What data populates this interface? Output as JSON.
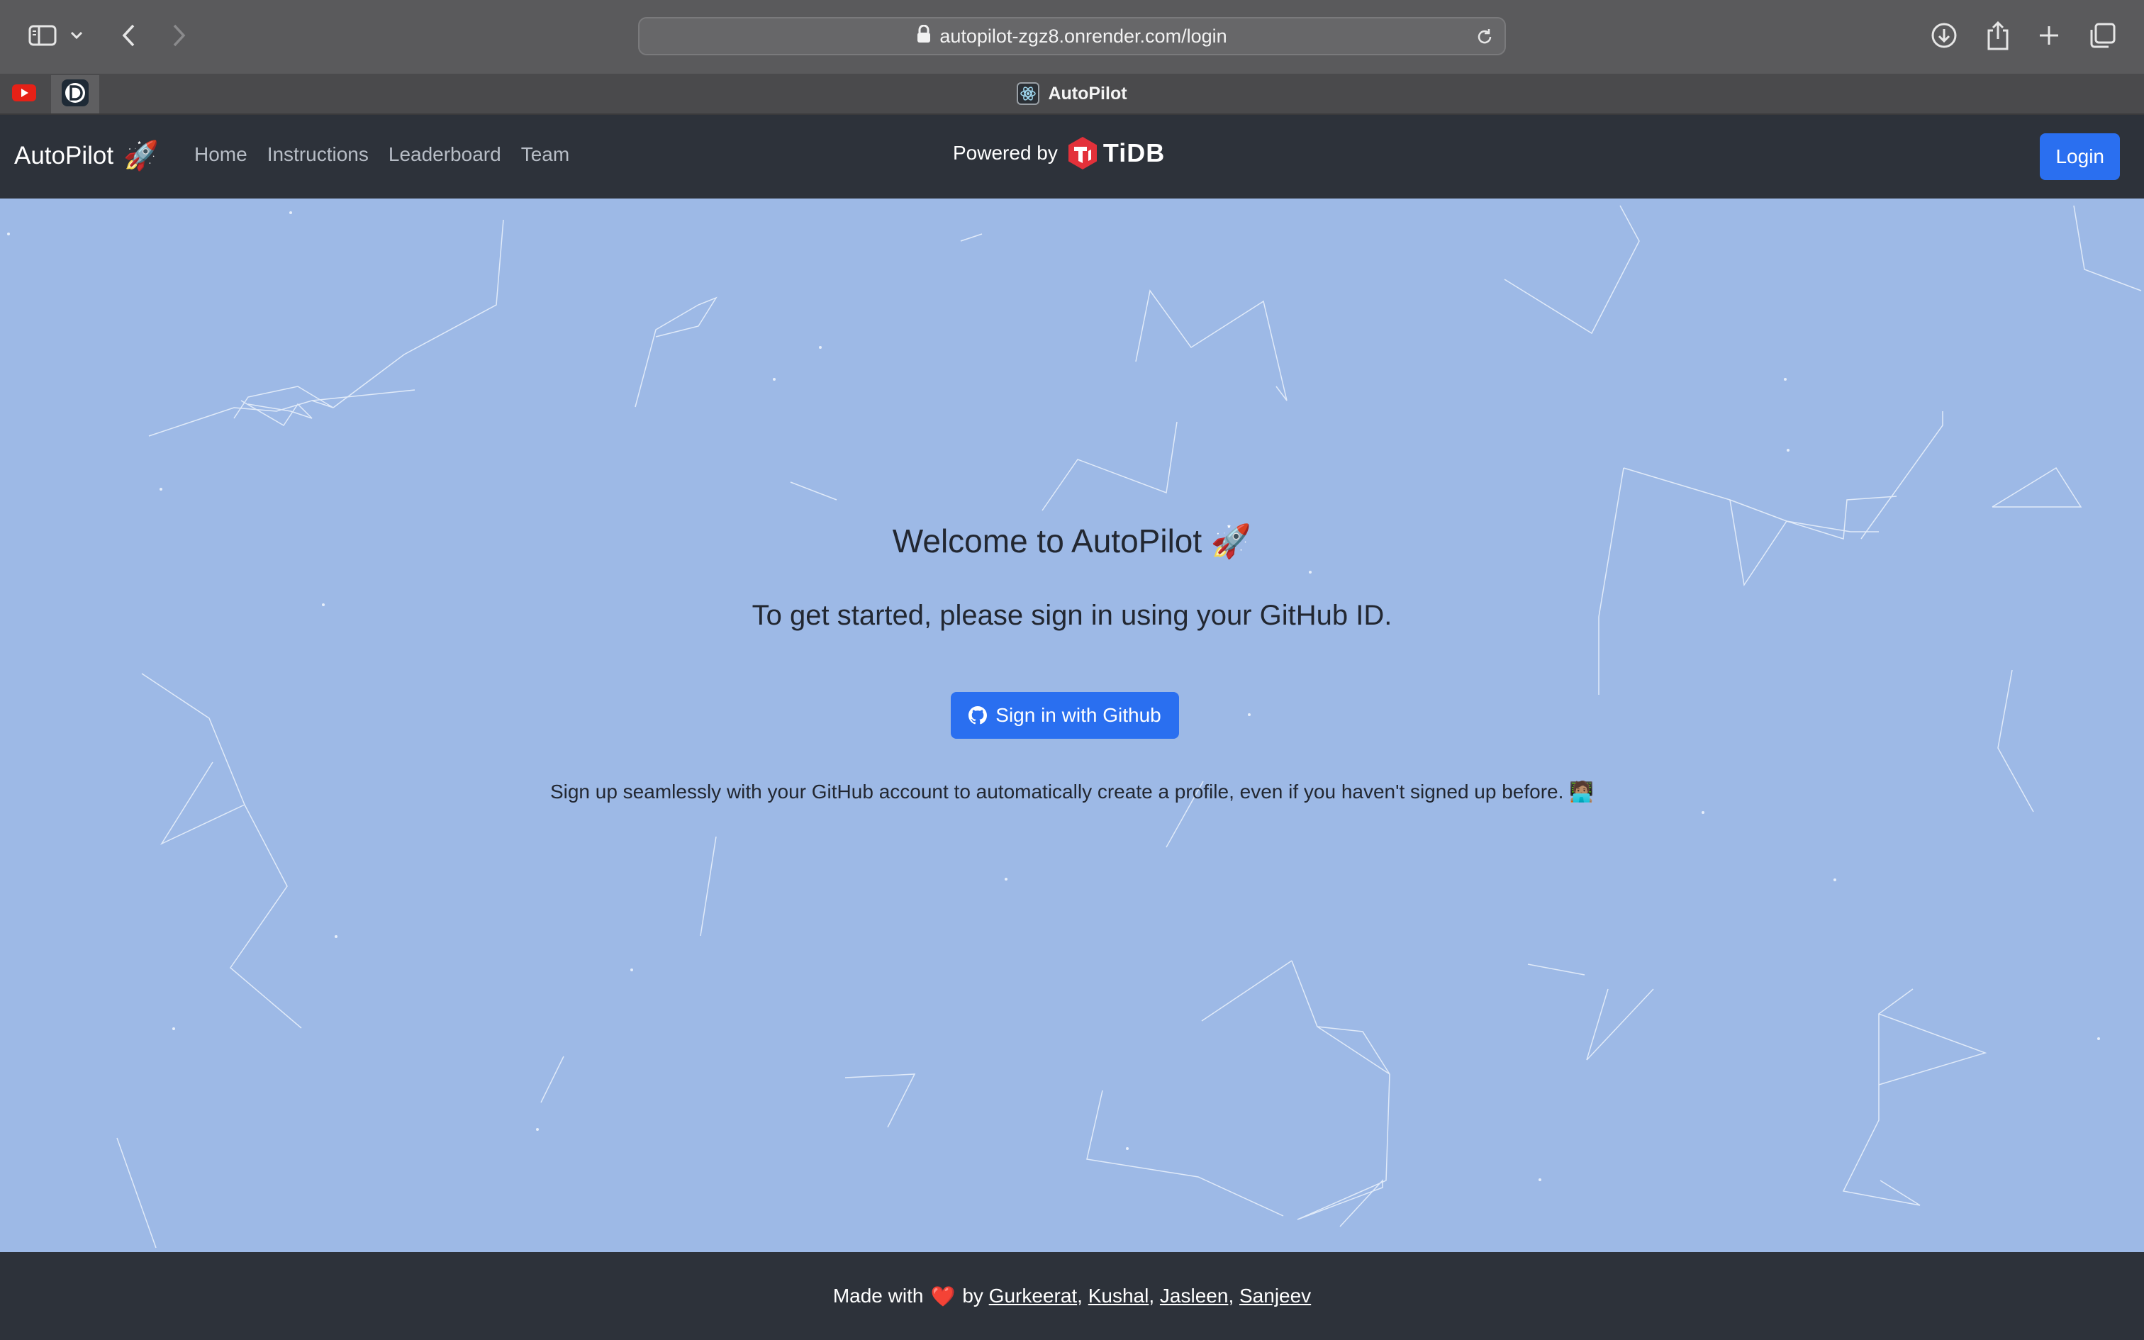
{
  "browser": {
    "url": "autopilot-zgz8.onrender.com/login",
    "tab_title": "AutoPilot",
    "icons": [
      "sidebar-icon",
      "chevron-down-icon",
      "back-icon",
      "forward-icon",
      "lock-icon",
      "reload-icon",
      "download-icon",
      "share-icon",
      "new-tab-icon",
      "tab-overview-icon",
      "youtube-icon",
      "d-app-icon"
    ]
  },
  "navbar": {
    "brand": "AutoPilot",
    "brand_emoji": "🚀",
    "links": [
      "Home",
      "Instructions",
      "Leaderboard",
      "Team"
    ],
    "powered_by": "Powered by",
    "sponsor": "TiDB",
    "login_label": "Login"
  },
  "main": {
    "welcome": "Welcome to AutoPilot 🚀",
    "subtitle": "To get started, please sign in using your GitHub ID.",
    "github_button": "Sign in with Github",
    "note": "Sign up seamlessly with your GitHub account to automatically create a profile, even if you haven't signed up before. 🧑🏽‍💻"
  },
  "footer": {
    "made_with": "Made with",
    "heart": "❤️",
    "by": "by",
    "authors": [
      "Gurkeerat",
      "Kushal",
      "Jasleen",
      "Sanjeev"
    ]
  },
  "colors": {
    "navbar_bg": "#2d323a",
    "main_bg": "#9db9e6",
    "primary": "#2a6ff0",
    "tidb_red": "#e3313a"
  }
}
